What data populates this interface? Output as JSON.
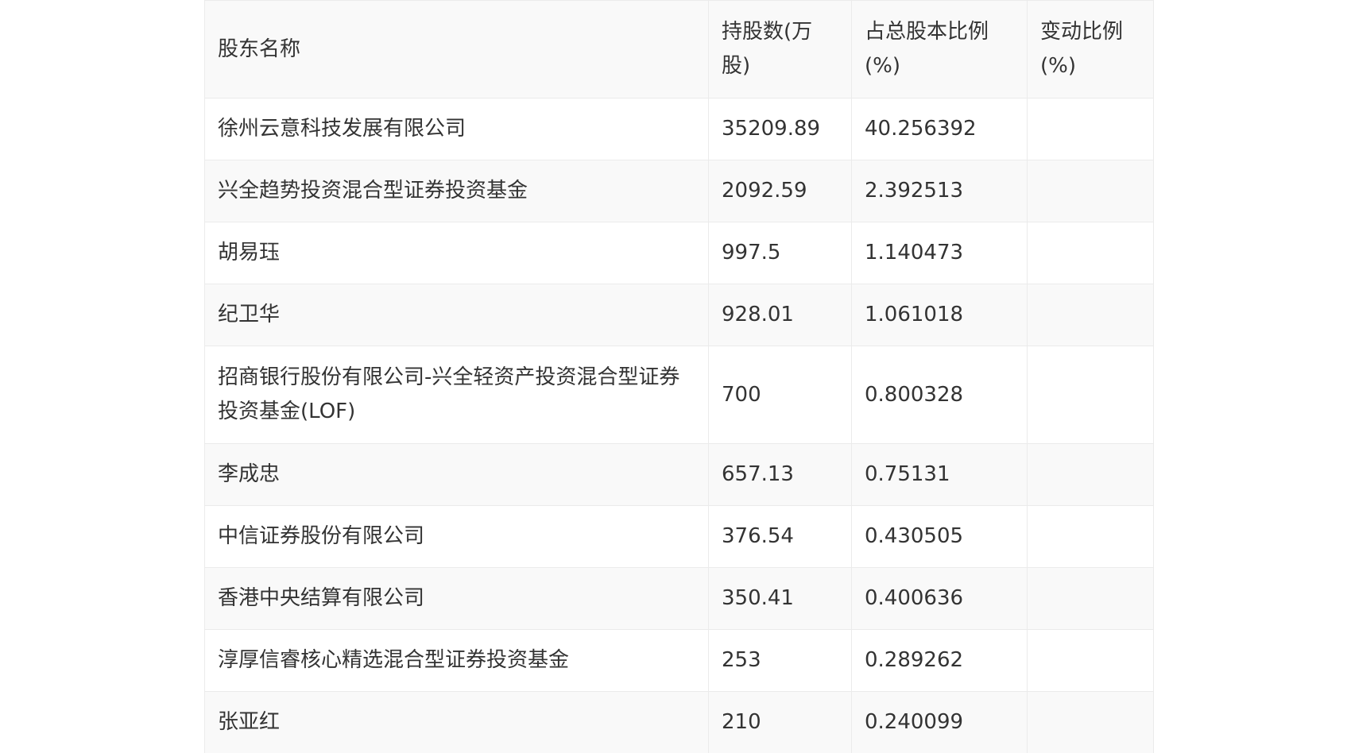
{
  "table": {
    "headers": {
      "name": "股东名称",
      "shares": "持股数(万股)",
      "pct": "占总股本比例(%)",
      "change": "变动比例(%)"
    },
    "rows": [
      {
        "name": "徐州云意科技发展有限公司",
        "shares": "35209.89",
        "pct": "40.256392",
        "change": ""
      },
      {
        "name": "兴全趋势投资混合型证券投资基金",
        "shares": "2092.59",
        "pct": "2.392513",
        "change": ""
      },
      {
        "name": "胡易珏",
        "shares": "997.5",
        "pct": "1.140473",
        "change": ""
      },
      {
        "name": "纪卫华",
        "shares": "928.01",
        "pct": "1.061018",
        "change": ""
      },
      {
        "name": "招商银行股份有限公司-兴全轻资产投资混合型证券投资基金(LOF)",
        "shares": "700",
        "pct": "0.800328",
        "change": ""
      },
      {
        "name": "李成忠",
        "shares": "657.13",
        "pct": "0.75131",
        "change": ""
      },
      {
        "name": "中信证券股份有限公司",
        "shares": "376.54",
        "pct": "0.430505",
        "change": ""
      },
      {
        "name": "香港中央结算有限公司",
        "shares": "350.41",
        "pct": "0.400636",
        "change": ""
      },
      {
        "name": "淳厚信睿核心精选混合型证券投资基金",
        "shares": "253",
        "pct": "0.289262",
        "change": ""
      },
      {
        "name": "张亚红",
        "shares": "210",
        "pct": "0.240099",
        "change": ""
      }
    ]
  }
}
